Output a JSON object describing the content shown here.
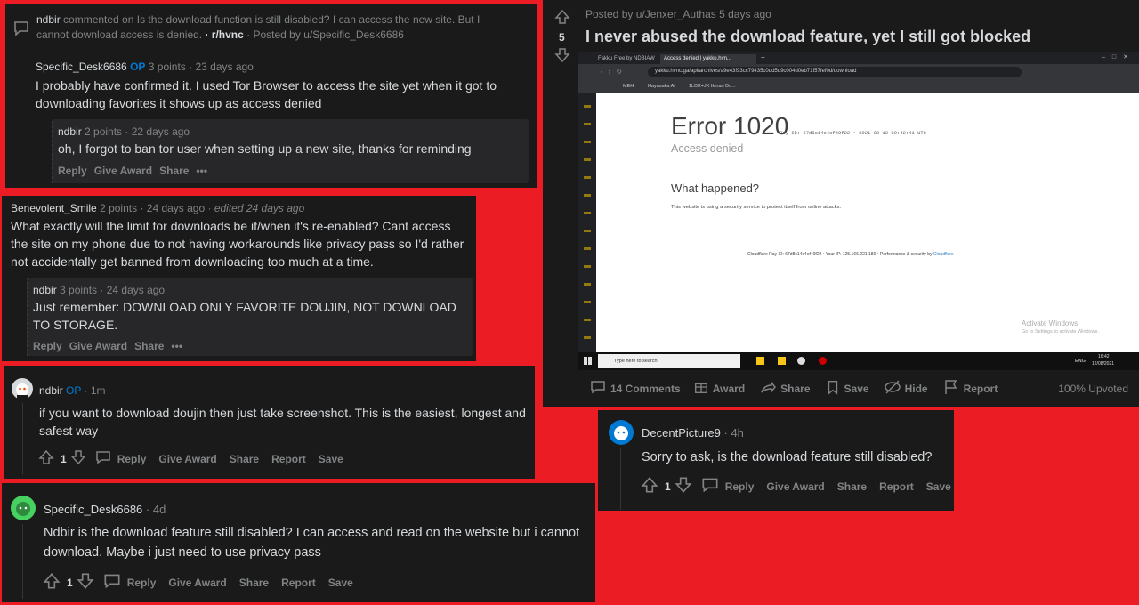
{
  "p1": {
    "header_user": "ndbir",
    "header_mid": "commented on",
    "header_title": "Is the download function is still disabled? I can access the new site. But I cannot download access is denied.",
    "subreddit": "· r/hvnc",
    "posted_by": "· Posted by u/Specific_Desk6686",
    "reply1_user": "Specific_Desk6686",
    "reply1_op": "OP",
    "reply1_meta": "3 points · 23 days ago",
    "reply1_text": "I probably have confirmed it. I used Tor Browser to access the site yet when it got to downloading favorites it shows up as access denied",
    "reply2_user": "ndbir",
    "reply2_meta": "2 points · 22 days ago",
    "reply2_text": "oh, I forgot to ban tor user when setting up a new site, thanks for reminding",
    "actions": [
      "Reply",
      "Give Award",
      "Share",
      "•••"
    ]
  },
  "p2": {
    "user": "Benevolent_Smile",
    "meta": "2 points · 24 days ago",
    "edited": "· edited 24 days ago",
    "text": "What exactly will the limit for downloads be if/when it's re-enabled? Cant access the site on my phone due to not having workarounds like privacy pass so I'd rather not accidentally get banned from downloading too much at a time.",
    "reply_user": "ndbir",
    "reply_meta": "3 points · 24 days ago",
    "reply_text": "Just remember: DOWNLOAD ONLY FAVORITE DOUJIN, NOT DOWNLOAD TO STORAGE.",
    "actions": [
      "Reply",
      "Give Award",
      "Share",
      "•••"
    ]
  },
  "p3": {
    "user": "ndbir",
    "op": "OP",
    "meta": "· 1m",
    "text": "if you want to download doujin then just take screenshot. This is the easiest, longest and safest way",
    "votes": "1",
    "actions": [
      "Reply",
      "Give Award",
      "Share",
      "Report",
      "Save"
    ]
  },
  "p4": {
    "user": "Specific_Desk6686",
    "meta": "· 4d",
    "text": "Ndbir is the download feature still disabled? I can access and read on the website but i cannot download. Maybe i just need to use privacy pass",
    "votes": "1",
    "actions": [
      "Reply",
      "Give Award",
      "Share",
      "Report",
      "Save"
    ]
  },
  "p5": {
    "posted_by": "Posted by u/Jenxer_Authas 5 days ago",
    "votes": "5",
    "title": "I never abused the download feature, yet I still got blocked",
    "browser": {
      "tab1": "Fakku Free by NDBIAW",
      "tab2": "Access denied | yakku.hvn...",
      "url": "yakku.hvnc.ga/api/archives/a9e43f93cc79435c0dd5d9c004d0eb71f57fef0d/download",
      "bookmarks": [
        "MEH",
        "Hayasaka Ai",
        "1LDK+JK Ikinari Do..."
      ],
      "error_title": "Error 1020",
      "ray_line": "Ray ID: 67d8c14c4ef40f22 • 2021-08-12 09:42:41 UTC",
      "access_denied": "Access denied",
      "what_happened": "What happened?",
      "desc": "This website is using a security service to protect itself from online attacks.",
      "footer": "Cloudflare Ray ID: 67d8c14c4ef40f22 • Your IP: 125.166.221.180 • Performance & security by",
      "footer_link": "Cloudflare",
      "activate1": "Activate Windows",
      "activate2": "Go to Settings to activate Windows.",
      "search": "Type here to search",
      "lang": "ENG",
      "time": "16:42",
      "date": "12/08/2021"
    },
    "comments": "14 Comments",
    "actions": [
      "Award",
      "Share",
      "Save",
      "Hide",
      "Report"
    ],
    "upvoted": "100% Upvoted"
  },
  "p6": {
    "user": "DecentPicture9",
    "meta": "· 4h",
    "text": "Sorry to ask, is the download feature still disabled?",
    "votes": "1",
    "actions": [
      "Reply",
      "Give Award",
      "Share",
      "Report",
      "Save"
    ]
  }
}
